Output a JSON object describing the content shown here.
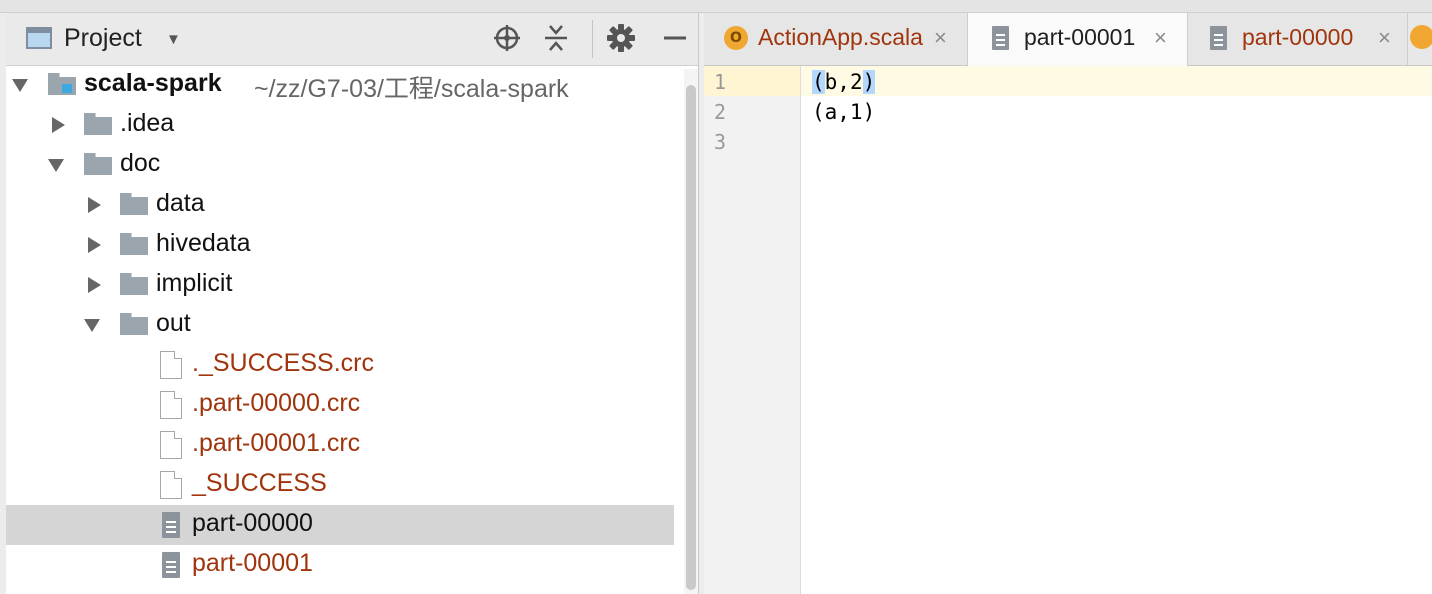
{
  "project": {
    "title": "Project",
    "dropdown_icon": "triangle-down-icon",
    "header_icons": [
      "locate-crosshair-icon",
      "collapse-all-icon",
      "gear-icon",
      "minimize-icon"
    ],
    "tree": {
      "root": {
        "label": "scala-spark",
        "path": "~/zz/G7-03/工程/scala-spark"
      },
      "items": [
        {
          "label": ".idea"
        },
        {
          "label": "doc"
        },
        {
          "label": "data"
        },
        {
          "label": "hivedata"
        },
        {
          "label": "implicit"
        },
        {
          "label": "out"
        },
        {
          "label": "._SUCCESS.crc"
        },
        {
          "label": ".part-00000.crc"
        },
        {
          "label": ".part-00001.crc"
        },
        {
          "label": "_SUCCESS"
        },
        {
          "label": "part-00000"
        },
        {
          "label": "part-00001"
        }
      ],
      "selected": "part-00000"
    }
  },
  "editor": {
    "tabs": [
      {
        "label": "ActionApp.scala",
        "icon": "scala-object-icon",
        "close": "×"
      },
      {
        "label": "part-00001",
        "icon": "text-file-icon",
        "close": "×",
        "active": true
      },
      {
        "label": "part-00000",
        "icon": "text-file-icon",
        "close": "×"
      }
    ],
    "line_numbers": [
      "1",
      "2",
      "3"
    ],
    "lines": {
      "l1_open": "(",
      "l1_mid": "b,2",
      "l1_close": ")",
      "l2": "(a,1)",
      "l3": ""
    }
  },
  "colors": {
    "modified_file_text": "#a0350d",
    "selection": "#d5d5d5",
    "current_line": "#fffae3",
    "brace_highlight": "#b3d7ff",
    "module_marker": "#3ea8e1"
  }
}
